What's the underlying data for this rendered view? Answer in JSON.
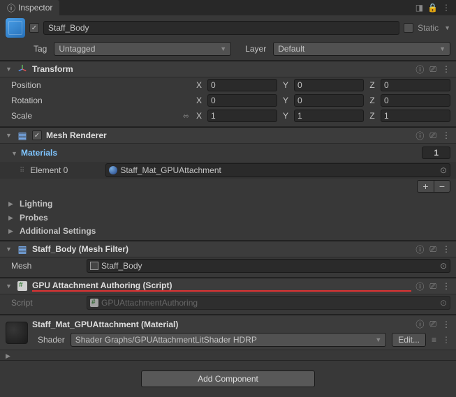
{
  "tab": {
    "title": "Inspector"
  },
  "gameObject": {
    "enabled_check": "✓",
    "name": "Staff_Body",
    "static_label": "Static",
    "tag_label": "Tag",
    "tag_value": "Untagged",
    "layer_label": "Layer",
    "layer_value": "Default"
  },
  "transform": {
    "title": "Transform",
    "position_label": "Position",
    "rotation_label": "Rotation",
    "scale_label": "Scale",
    "x_label": "X",
    "y_label": "Y",
    "z_label": "Z",
    "pos": {
      "x": "0",
      "y": "0",
      "z": "0"
    },
    "rot": {
      "x": "0",
      "y": "0",
      "z": "0"
    },
    "scale": {
      "x": "1",
      "y": "1",
      "z": "1"
    }
  },
  "meshRenderer": {
    "title": "Mesh Renderer",
    "enabled_check": "✓",
    "materials_label": "Materials",
    "materials_count": "1",
    "element0_label": "Element 0",
    "element0_value": "Staff_Mat_GPUAttachment",
    "lighting_label": "Lighting",
    "probes_label": "Probes",
    "additional_label": "Additional Settings"
  },
  "meshFilter": {
    "title": "Staff_Body (Mesh Filter)",
    "mesh_label": "Mesh",
    "mesh_value": "Staff_Body"
  },
  "gpuScript": {
    "title": "GPU Attachment Authoring (Script)",
    "script_label": "Script",
    "script_value": "GPUAttachmentAuthoring"
  },
  "material": {
    "title": "Staff_Mat_GPUAttachment (Material)",
    "shader_label": "Shader",
    "shader_value": "Shader Graphs/GPUAttachmentLitShader HDRP",
    "edit_label": "Edit..."
  },
  "addComponent": {
    "label": "Add Component"
  },
  "icons": {
    "help": "?",
    "preset": "⎚",
    "menu": "⋮",
    "plus": "+",
    "minus": "−",
    "picker": "⊙",
    "link": "⬄",
    "lock": "🔒",
    "foldout_right": "▶",
    "foldout_down": "▼",
    "list_toggle": "≡"
  }
}
